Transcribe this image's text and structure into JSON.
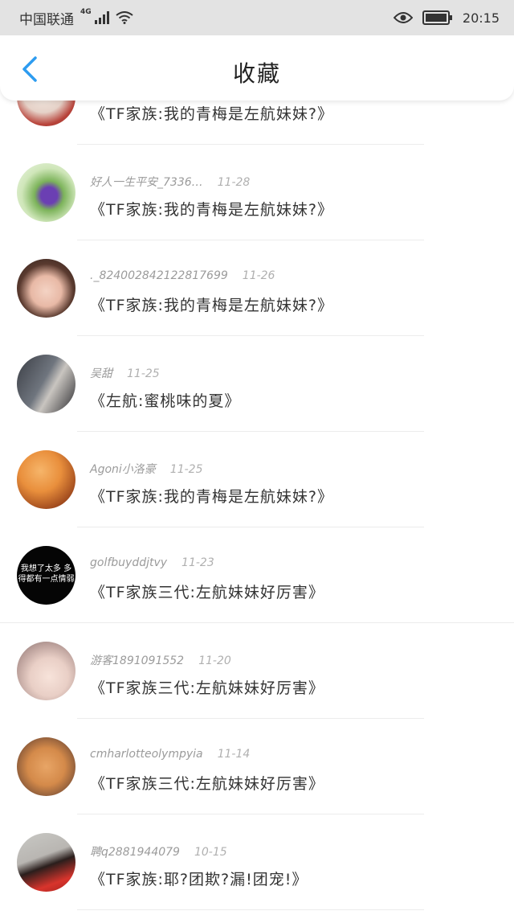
{
  "status_bar": {
    "carrier": "中国联通",
    "network": "4G",
    "time": "20:15"
  },
  "header": {
    "title": "收藏"
  },
  "favorites": [
    {
      "name": "",
      "date": "",
      "work": "《TF家族:我的青梅是左航妹妹?》"
    },
    {
      "name": "好人一生平安_7336…",
      "date": "11-28",
      "work": "《TF家族:我的青梅是左航妹妹?》"
    },
    {
      "name": "._824002842122817699",
      "date": "11-26",
      "work": "《TF家族:我的青梅是左航妹妹?》"
    },
    {
      "name": "吴甜",
      "date": "11-25",
      "work": "《左航:蜜桃味的夏》"
    },
    {
      "name": "Agoni小洛豪",
      "date": "11-25",
      "work": "《TF家族:我的青梅是左航妹妹?》"
    },
    {
      "name": "golfbuyddjtvy",
      "date": "11-23",
      "work": "《TF家族三代:左航妹妹好厉害》",
      "avatar_text": "我想了太多 多得都有一点情弱"
    },
    {
      "name": "游客1891091552",
      "date": "11-20",
      "work": "《TF家族三代:左航妹妹好厉害》"
    },
    {
      "name": "cmharlotteolympyia",
      "date": "11-14",
      "work": "《TF家族三代:左航妹妹好厉害》"
    },
    {
      "name": "聘q2881944079",
      "date": "10-15",
      "work": "《TF家族:耶?团欺?漏!团宠!》"
    }
  ]
}
